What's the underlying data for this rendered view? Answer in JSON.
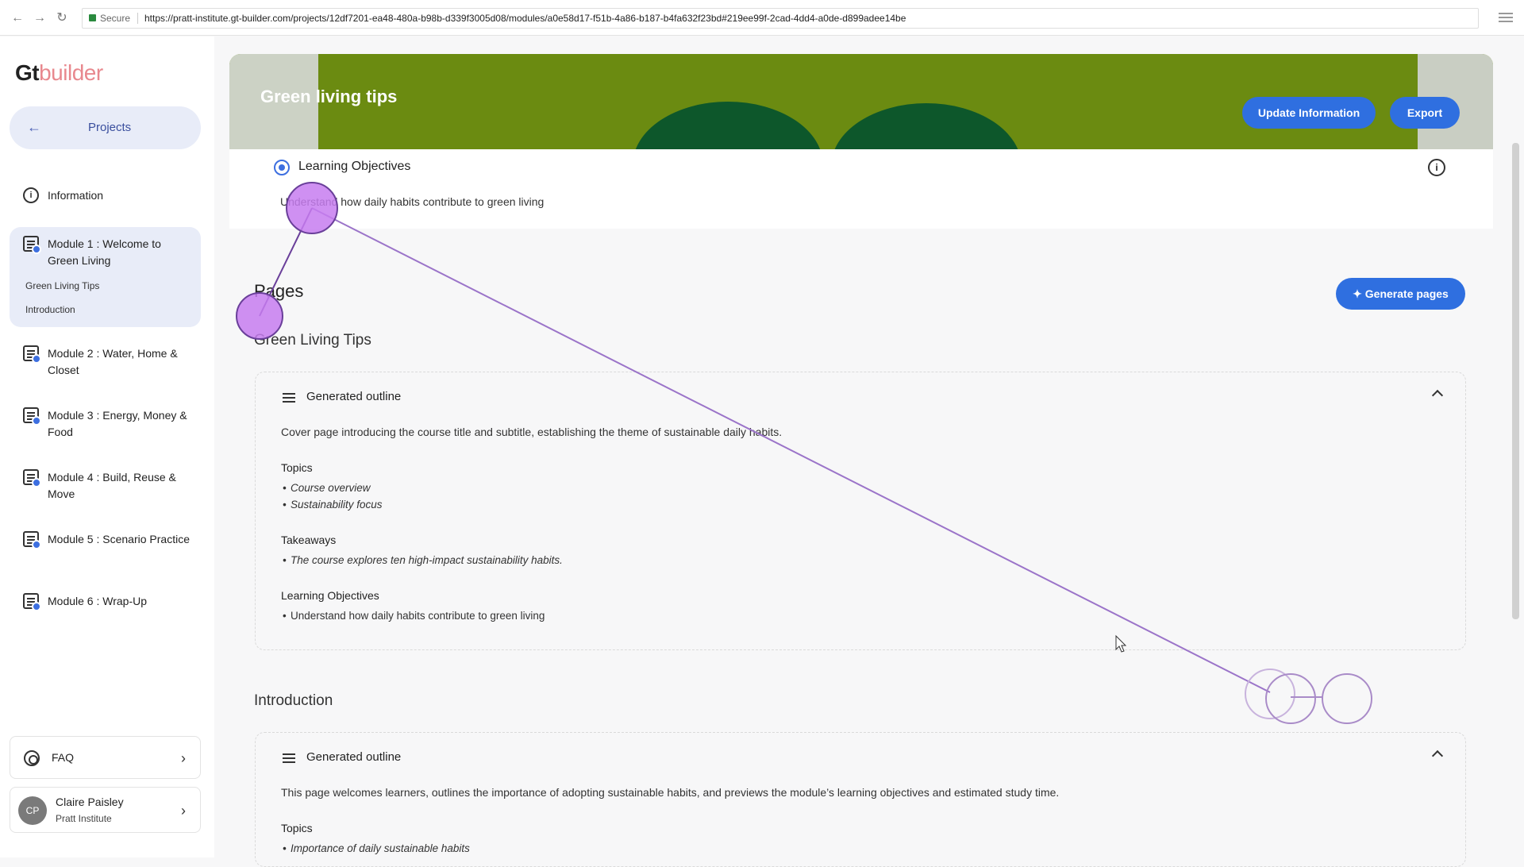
{
  "browser": {
    "secure_label": "Secure",
    "url": "https://pratt-institute.gt-builder.com/projects/12df7201-ea48-480a-b98b-d339f3005d08/modules/a0e58d17-f51b-4a86-b187-b4fa632f23bd#219ee99f-2cad-4dd4-a0de-d899adee14be"
  },
  "sidebar": {
    "logo_gt": "Gt",
    "logo_builder": "builder",
    "projects_label": "Projects",
    "information_label": "Information",
    "modules": [
      {
        "label": "Module 1 : Welcome to Green Living",
        "active": true
      },
      {
        "label": "Module 2 : Water, Home & Closet"
      },
      {
        "label": "Module 3 : Energy, Money & Food"
      },
      {
        "label": "Module 4 : Build, Reuse & Move"
      },
      {
        "label": "Module 5 : Scenario Practice"
      },
      {
        "label": "Module 6 : Wrap-Up"
      }
    ],
    "sub_pages": [
      "Green Living Tips",
      "Introduction"
    ],
    "faq_label": "FAQ",
    "user": {
      "initials": "CP",
      "name": "Claire Paisley",
      "org": "Pratt Institute"
    }
  },
  "header": {
    "title": "Green living tips",
    "update_button": "Update Information",
    "export_button": "Export"
  },
  "objectives": {
    "title": "Learning Objectives",
    "items": [
      "Understand how daily habits contribute to green living"
    ]
  },
  "pages": {
    "heading": "Pages",
    "generate_button": "Generate pages",
    "sections": [
      {
        "title": "Green Living Tips",
        "outline_title": "Generated outline",
        "description": "Cover page introducing the course title and subtitle, establishing the theme of sustainable daily habits.",
        "topics_label": "Topics",
        "topics": [
          "Course overview",
          "Sustainability focus"
        ],
        "takeaways_label": "Takeaways",
        "takeaways": [
          "The course explores ten high-impact sustainability habits."
        ],
        "objectives_label": "Learning Objectives",
        "objectives": [
          "Understand how daily habits contribute to green living"
        ]
      },
      {
        "title": "Introduction",
        "outline_title": "Generated outline",
        "description": "This page welcomes learners, outlines the importance of adopting sustainable habits, and previews the module’s learning objectives and estimated study time.",
        "topics_label": "Topics",
        "topics": [
          "Importance of daily sustainable habits"
        ]
      }
    ]
  },
  "colors": {
    "accent": "#2f6fe0",
    "active_bg": "#e8ecf8",
    "hero_green": "#7a9f14",
    "hero_dark": "#0f6331",
    "overlay_purple": "#c77df0"
  }
}
